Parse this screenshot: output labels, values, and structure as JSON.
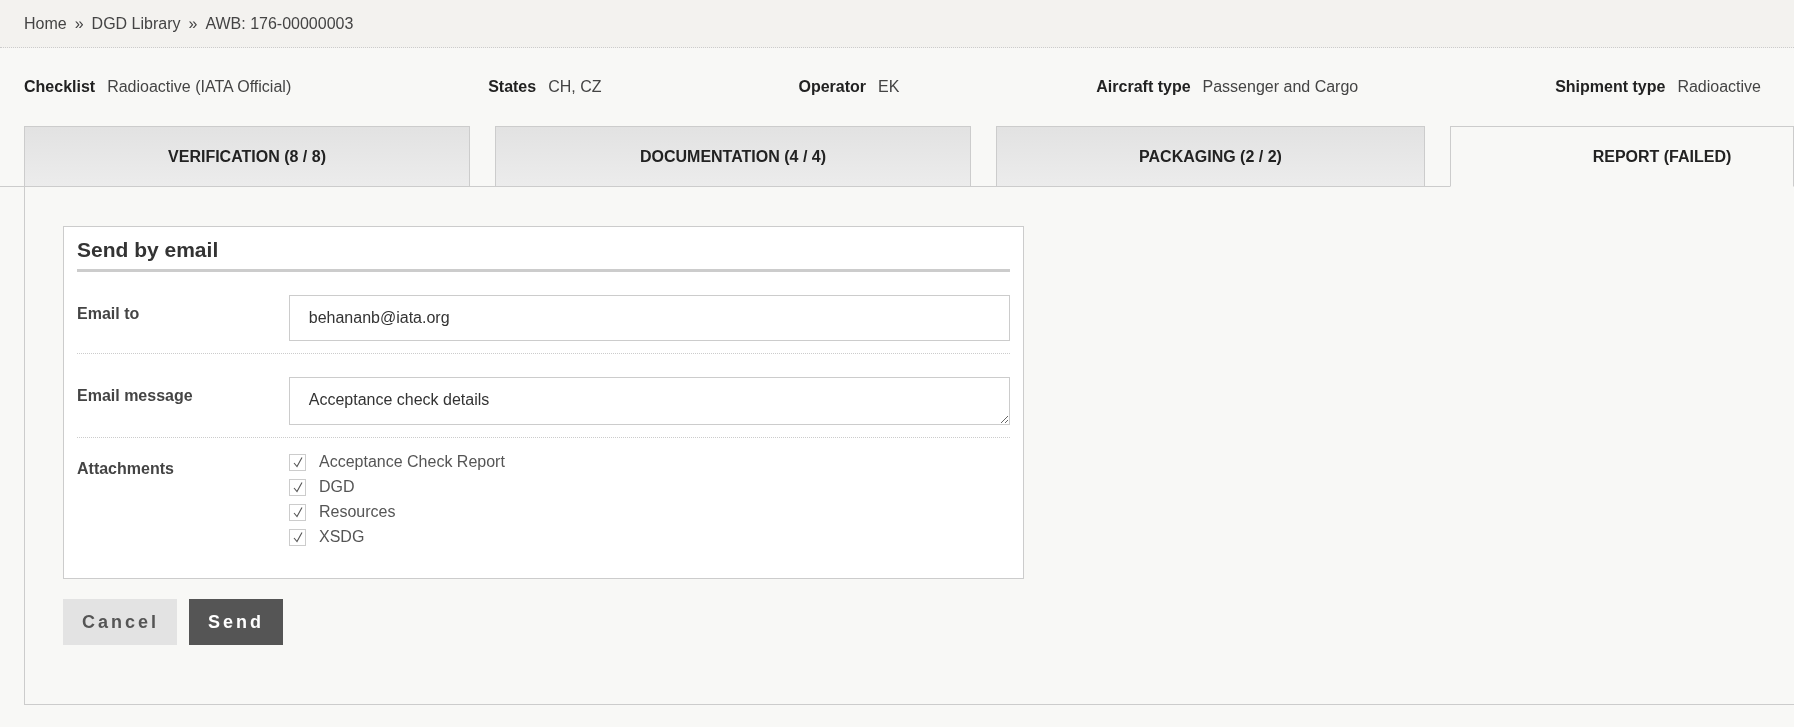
{
  "breadcrumb": [
    "Home",
    "DGD Library",
    "AWB: 176-00000003"
  ],
  "breadcrumb_separator": "»",
  "summary": [
    {
      "label": "Checklist",
      "value": "Radioactive (IATA Official)"
    },
    {
      "label": "States",
      "value": "CH, CZ"
    },
    {
      "label": "Operator",
      "value": "EK"
    },
    {
      "label": "Aircraft type",
      "value": "Passenger and Cargo"
    },
    {
      "label": "Shipment type",
      "value": "Radioactive"
    }
  ],
  "tabs": [
    {
      "label": "VERIFICATION (8 / 8)",
      "selected": false
    },
    {
      "label": "DOCUMENTATION (4 / 4)",
      "selected": false
    },
    {
      "label": "PACKAGING (2 / 2)",
      "selected": false
    },
    {
      "label": "REPORT (FAILED)",
      "selected": true
    }
  ],
  "email_form": {
    "title": "Send by email",
    "email_to": {
      "label": "Email to",
      "value": "behananb@iata.org"
    },
    "email_message": {
      "label": "Email message",
      "value": "Acceptance check details"
    },
    "attachments": {
      "label": "Attachments",
      "items": [
        {
          "label": "Acceptance Check Report",
          "checked": true
        },
        {
          "label": "DGD",
          "checked": true
        },
        {
          "label": "Resources",
          "checked": true
        },
        {
          "label": "XSDG",
          "checked": true
        }
      ]
    }
  },
  "buttons": [
    {
      "label": "Cancel",
      "kind": "secondary"
    },
    {
      "label": "Send",
      "kind": "primary"
    }
  ]
}
